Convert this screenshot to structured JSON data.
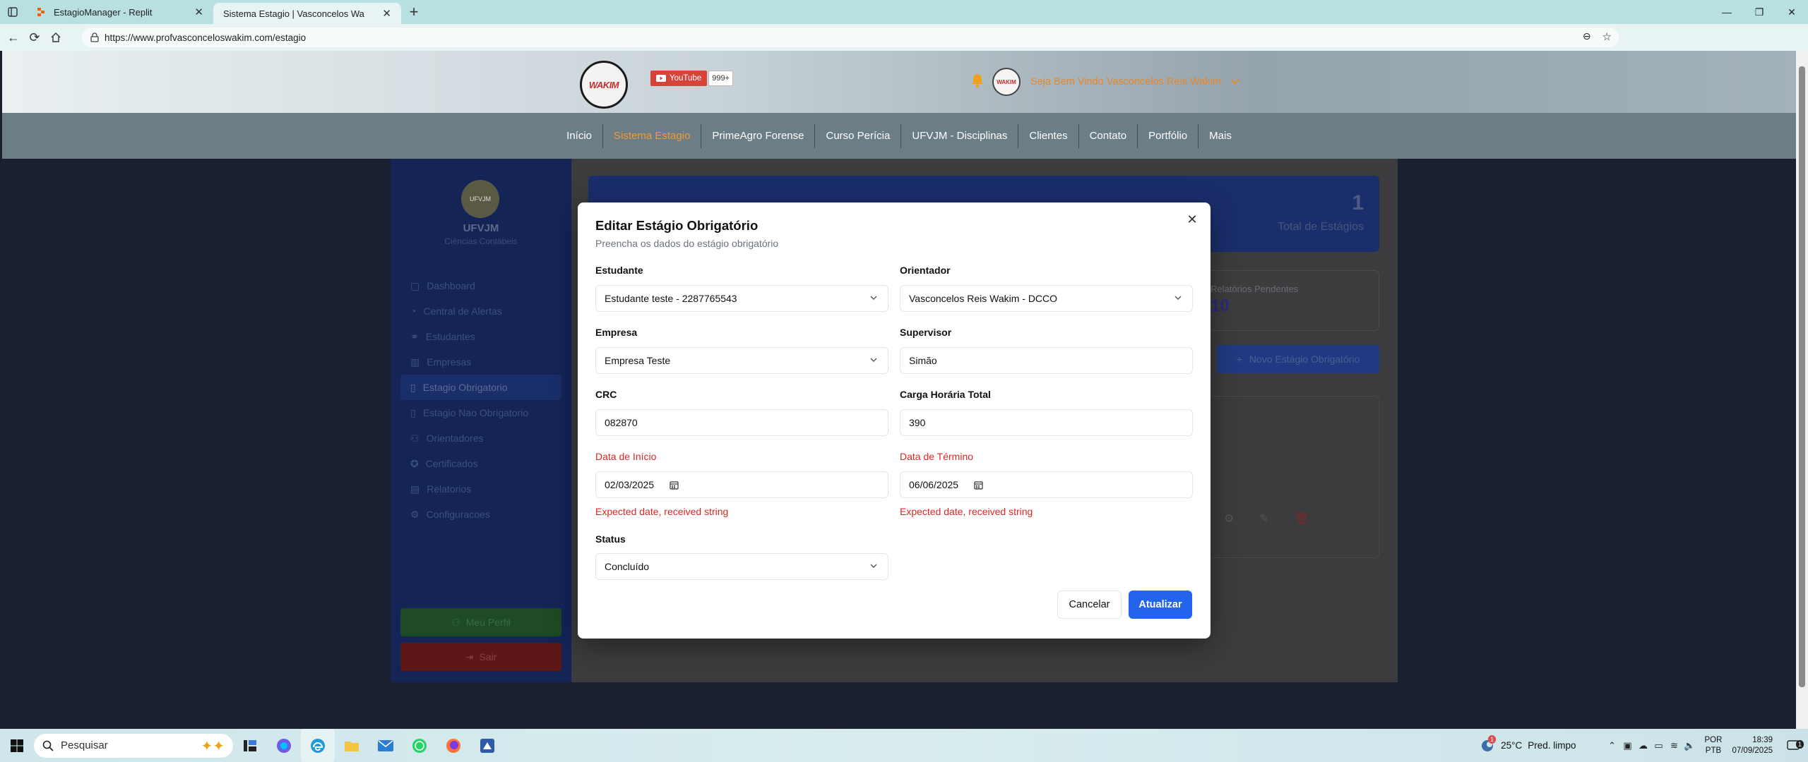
{
  "browser": {
    "tabs": [
      {
        "title": "EstagioManager - Replit",
        "active": false
      },
      {
        "title": "Sistema Estagio | Vasconcelos Wa",
        "active": true
      }
    ],
    "url": "https://www.profvasconceloswakim.com/estagio"
  },
  "site": {
    "logo_text": "WAKIM",
    "youtube_label": "YouTube",
    "youtube_count": "999+",
    "welcome": "Seja Bem Vindo Vasconcelos Reis Wakim",
    "nav": [
      "Início",
      "Sistema Estagio",
      "PrimeAgro Forense",
      "Curso Perícia",
      "UFVJM - Disciplinas",
      "Clientes",
      "Contato",
      "Portfólio",
      "Mais"
    ],
    "nav_active": "Sistema Estagio",
    "accent_color": "#e7872b"
  },
  "app": {
    "org": "UFVJM",
    "org_sub": "Ciências Contábeis",
    "logo_text": "UFVJM",
    "menu": [
      "Dashboard",
      "Central de Alertas",
      "Estudantes",
      "Empresas",
      "Estagio Obrigatorio",
      "Estagio Nao Obrigatorio",
      "Orientadores",
      "Certificados",
      "Relatorios",
      "Configuracoes"
    ],
    "menu_active": "Estagio Obrigatorio",
    "profile_button": "Meu Perfil",
    "logout_button": "Sair",
    "banner_count": "1",
    "banner_count_label": "Total de Estágios",
    "card_title": "Relatórios Pendentes",
    "card_value": "10",
    "new_button": "Novo Estágio Obrigatório"
  },
  "modal": {
    "title": "Editar Estágio Obrigatório",
    "description": "Preencha os dados do estágio obrigatório",
    "fields": {
      "estudante": {
        "label": "Estudante",
        "value": "Estudante teste - 2287765543"
      },
      "orientador": {
        "label": "Orientador",
        "value": "Vasconcelos Reis Wakim - DCCO"
      },
      "empresa": {
        "label": "Empresa",
        "value": "Empresa Teste"
      },
      "supervisor": {
        "label": "Supervisor",
        "value": "Simão"
      },
      "crc": {
        "label": "CRC",
        "value": "082870"
      },
      "carga": {
        "label": "Carga Horária Total",
        "value": "390"
      },
      "inicio": {
        "label": "Data de Início",
        "value": "02/03/2025",
        "error": "Expected date, received string"
      },
      "termino": {
        "label": "Data de Término",
        "value": "06/06/2025",
        "error": "Expected date, received string"
      },
      "status": {
        "label": "Status",
        "value": "Concluído"
      }
    },
    "cancel_label": "Cancelar",
    "submit_label": "Atualizar",
    "primary_color": "#2463eb",
    "error_color": "#dc2626"
  },
  "taskbar": {
    "search_placeholder": "Pesquisar",
    "weather_temp": "25°C",
    "weather_desc": "Pred. limpo",
    "weather_badge": "1",
    "lang_line1": "POR",
    "lang_line2": "PTB",
    "time": "18:39",
    "date": "07/09/2025",
    "notif_count": "1"
  }
}
